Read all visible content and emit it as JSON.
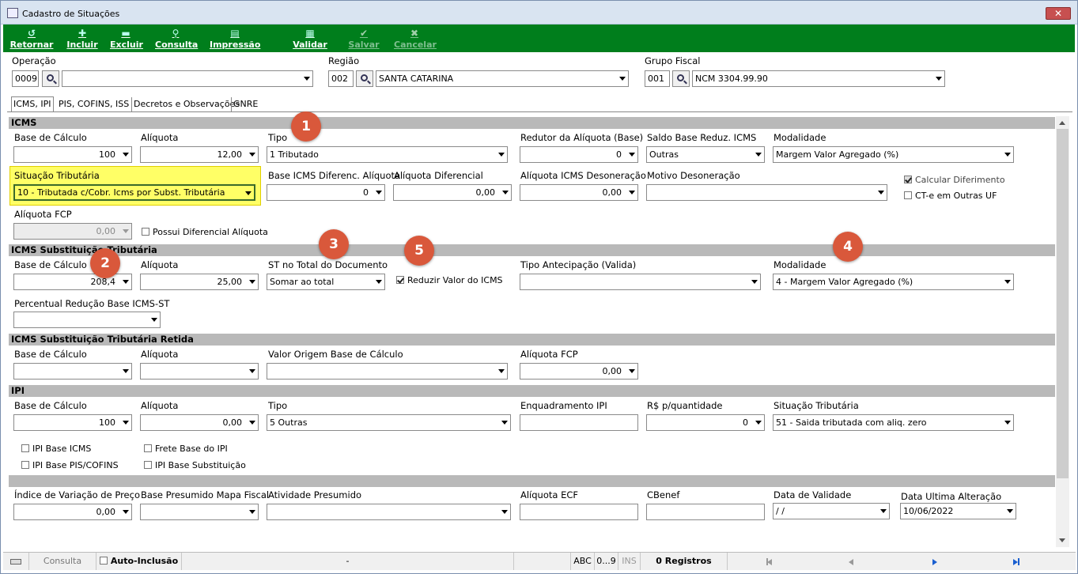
{
  "window": {
    "title": "Cadastro de Situações",
    "close": "✕"
  },
  "toolbar": [
    {
      "label": "Retornar",
      "icon": "return-icon",
      "glyph": "↺"
    },
    {
      "label": "Incluir",
      "icon": "add-icon",
      "glyph": "✚"
    },
    {
      "label": "Excluir",
      "icon": "delete-icon",
      "glyph": "▬"
    },
    {
      "label": "Consulta",
      "icon": "search-icon",
      "glyph": "⚲"
    },
    {
      "label": "Impressão",
      "icon": "printer-icon",
      "glyph": "▤"
    },
    {
      "label": "Validar",
      "icon": "validate-icon",
      "glyph": "▦"
    },
    {
      "label": "Salvar",
      "icon": "check-icon",
      "glyph": "✔"
    },
    {
      "label": "Cancelar",
      "icon": "cancel-icon",
      "glyph": "✖"
    }
  ],
  "header": {
    "operacao_label": "Operação",
    "operacao_code": "0009",
    "operacao_desc": "",
    "regiao_label": "Região",
    "regiao_code": "002",
    "regiao_desc": "SANTA CATARINA",
    "grupo_label": "Grupo Fiscal",
    "grupo_code": "001",
    "grupo_desc": "NCM 3304.99.90"
  },
  "tabs": [
    "ICMS, IPI",
    "PIS, COFINS, ISS",
    "Decretos e Observações",
    "GNRE"
  ],
  "icms": {
    "title": "ICMS",
    "base_calculo": {
      "label": "Base de Cálculo",
      "value": "100"
    },
    "aliquota": {
      "label": "Alíquota",
      "value": "12,00"
    },
    "tipo": {
      "label": "Tipo",
      "value": "1 Tributado"
    },
    "redutor": {
      "label": "Redutor da Alíquota (Base)",
      "value": "0"
    },
    "saldo": {
      "label": "Saldo Base Reduz. ICMS",
      "value": "Outras"
    },
    "modalidade": {
      "label": "Modalidade",
      "value": "Margem Valor Agregado (%)"
    },
    "situacao": {
      "label": "Situação Tributária",
      "value": "10 - Tributada c/Cobr. Icms por Subst. Tributária"
    },
    "base_difer": {
      "label": "Base ICMS Diferenc. Alíquota",
      "value": "0"
    },
    "aliq_difer": {
      "label": "Alíquota Diferencial",
      "value": "0,00"
    },
    "aliq_deson": {
      "label": "Alíquota ICMS Desoneração",
      "value": "0,00"
    },
    "motivo": {
      "label": "Motivo Desoneração",
      "value": ""
    },
    "calc_diferimento": "Calcular Diferimento",
    "cte_outras": "CT-e em Outras UF",
    "aliq_fcp": {
      "label": "Alíquota FCP",
      "value": "0,00"
    },
    "possui_difer": "Possui Diferencial Alíquota"
  },
  "st": {
    "title": "ICMS Substituição Tributária",
    "base_calculo": {
      "label": "Base de Cálculo",
      "value": "208,4"
    },
    "aliquota": {
      "label": "Alíquota",
      "value": "25,00"
    },
    "st_total": {
      "label": "ST no Total do Documento",
      "value": "Somar ao total"
    },
    "reduzir": "Reduzir Valor do ICMS",
    "tipo_antecip": {
      "label": "Tipo Antecipação (Valida)",
      "value": ""
    },
    "modalidade": {
      "label": "Modalidade",
      "value": "4 - Margem Valor Agregado (%)"
    },
    "perc_reducao": {
      "label": "Percentual Redução Base ICMS-ST",
      "value": ""
    }
  },
  "st_retida": {
    "title": "ICMS Substituição Tributária Retida",
    "base_calculo": {
      "label": "Base de Cálculo",
      "value": ""
    },
    "aliquota": {
      "label": "Alíquota",
      "value": ""
    },
    "valor_origem": {
      "label": "Valor Origem Base de Cálculo",
      "value": ""
    },
    "aliq_fcp": {
      "label": "Alíquota FCP",
      "value": "0,00"
    }
  },
  "ipi": {
    "title": "IPI",
    "base_calculo": {
      "label": "Base de Cálculo",
      "value": "100"
    },
    "aliquota": {
      "label": "Alíquota",
      "value": "0,00"
    },
    "tipo": {
      "label": "Tipo",
      "value": "5 Outras"
    },
    "enquadramento": {
      "label": "Enquadramento IPI",
      "value": ""
    },
    "rs_qtd": {
      "label": "R$ p/quantidade",
      "value": "0"
    },
    "situacao": {
      "label": "Situação Tributária",
      "value": "51 - Saida tributada com aliq. zero"
    },
    "ipi_base_icms": "IPI Base ICMS",
    "frete_base": "Frete Base do IPI",
    "ipi_base_pis": "IPI Base PIS/COFINS",
    "ipi_base_subst": "IPI Base Substituição"
  },
  "extra": {
    "indice": {
      "label": "Índice de Variação de Preço",
      "value": "0,00"
    },
    "base_presumido": {
      "label": "Base Presumido Mapa Fiscal",
      "value": ""
    },
    "atividade": {
      "label": "Atividade Presumido",
      "value": ""
    },
    "aliq_ecf": {
      "label": "Alíquota ECF",
      "value": ""
    },
    "cbenef": {
      "label": "CBenef",
      "value": ""
    },
    "data_validade": {
      "label": "Data de Validade",
      "value": " /  /"
    },
    "data_ultima": {
      "label": "Data Ultima Alteração",
      "value": "10/06/2022"
    }
  },
  "badges": [
    "1",
    "2",
    "3",
    "4",
    "5"
  ],
  "status": {
    "consulta": "Consulta",
    "auto_inclusao": "Auto-Inclusão",
    "dash": "-",
    "abc": "ABC",
    "num": "0...9",
    "ins": "INS",
    "registros": "0 Registros"
  },
  "colors": {
    "toolbar": "#007e1c",
    "badge": "#d9583b",
    "highlight": "#ffff66",
    "section": "#b9b9b9"
  }
}
